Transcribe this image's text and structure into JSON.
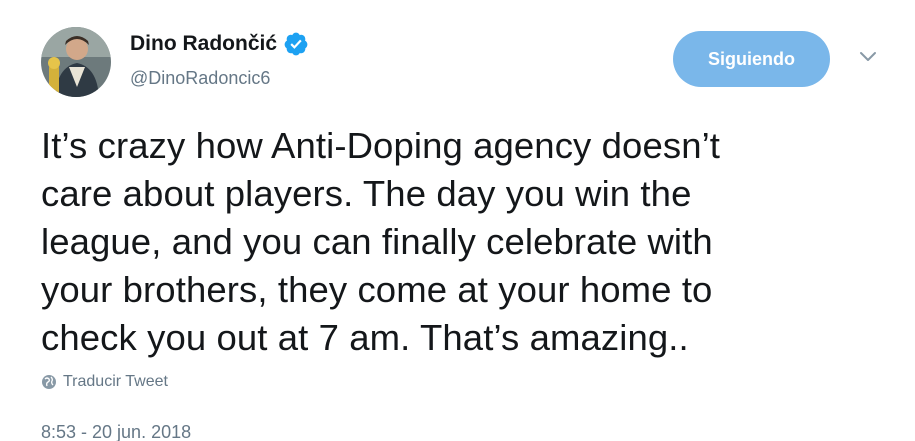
{
  "author": {
    "display_name": "Dino Radončić",
    "handle": "@DinoRadoncic6",
    "verified": true
  },
  "actions": {
    "follow_label": "Siguiendo"
  },
  "tweet": {
    "lines": [
      "It’s crazy how Anti-Doping agency doesn’t",
      "care about players. The day you win the",
      "league, and you can finally celebrate with",
      "your brothers, they come at your home to",
      "check you out at 7 am. That’s amazing.."
    ],
    "translate_label": "Traducir Tweet",
    "timestamp": "8:53 - 20 jun. 2018"
  },
  "icons": {
    "avatar": "avatar-photo",
    "verified": "verified-badge-icon",
    "caret": "chevron-down-icon",
    "translate": "globe-icon"
  },
  "colors": {
    "accent": "#1da1f2",
    "follow_button": "#7ab7ea",
    "secondary_text": "#657786",
    "primary_text": "#14171a"
  }
}
